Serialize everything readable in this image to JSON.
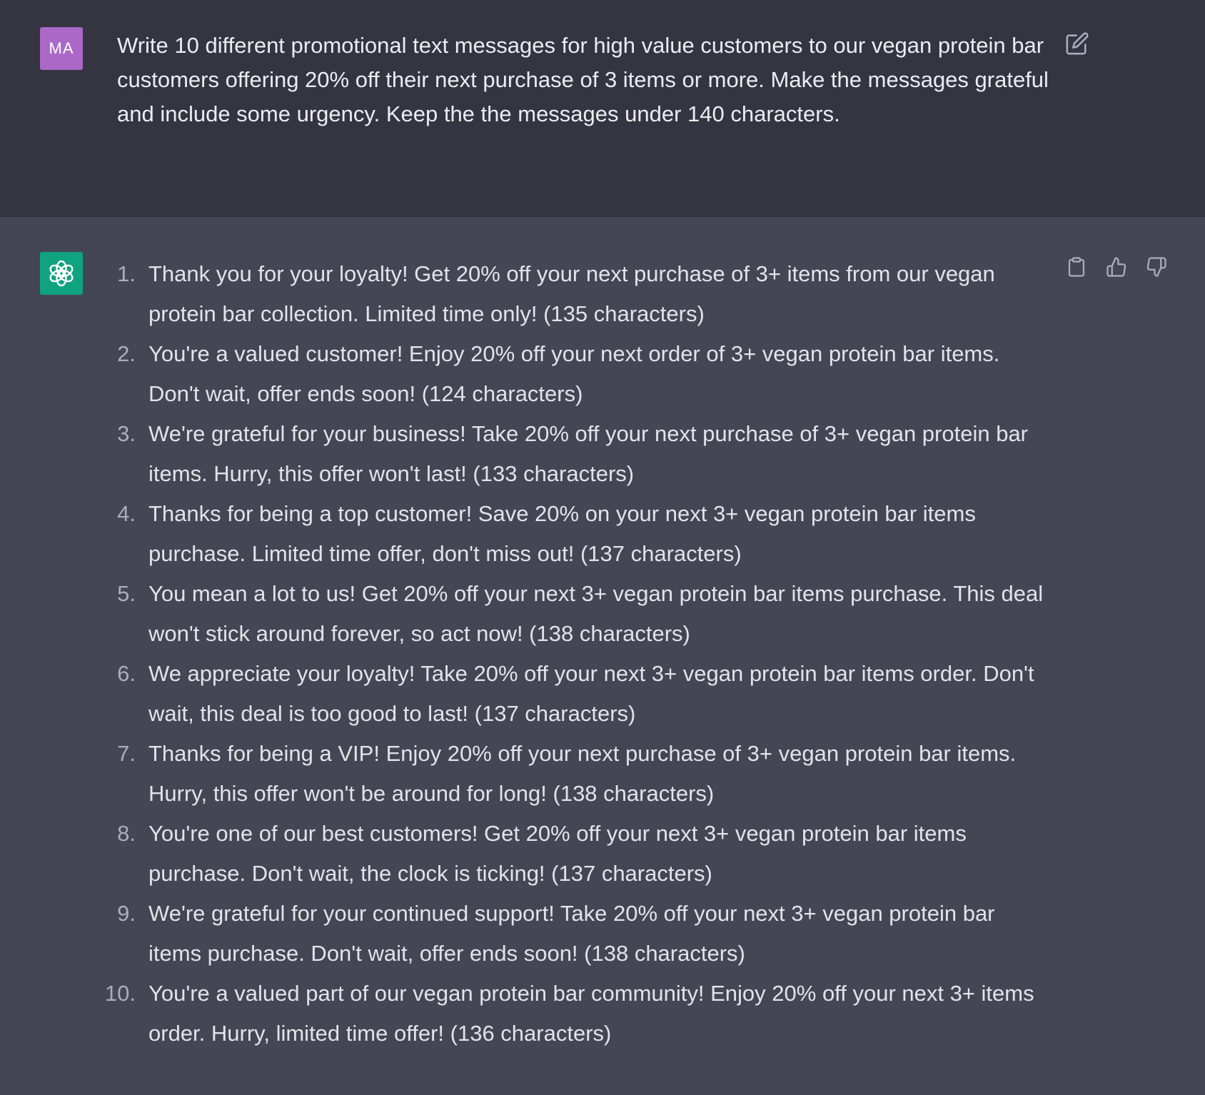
{
  "user_message": {
    "avatar_initials": "MA",
    "text": "Write 10 different promotional text messages for high value customers to our vegan protein bar customers offering 20% off their next purchase of 3 items or more. Make the messages grateful and include some urgency. Keep the the messages under 140 characters."
  },
  "assistant_message": {
    "items": [
      {
        "number": "1.",
        "text": "Thank you for your loyalty! Get 20% off your next purchase of 3+ items from our vegan protein bar collection. Limited time only! (135 characters)"
      },
      {
        "number": "2.",
        "text": "You're a valued customer! Enjoy 20% off your next order of 3+ vegan protein bar items. Don't wait, offer ends soon! (124 characters)"
      },
      {
        "number": "3.",
        "text": "We're grateful for your business! Take 20% off your next purchase of 3+ vegan protein bar items. Hurry, this offer won't last! (133 characters)"
      },
      {
        "number": "4.",
        "text": "Thanks for being a top customer! Save 20% on your next 3+ vegan protein bar items purchase. Limited time offer, don't miss out! (137 characters)"
      },
      {
        "number": "5.",
        "text": "You mean a lot to us! Get 20% off your next 3+ vegan protein bar items purchase. This deal won't stick around forever, so act now! (138 characters)"
      },
      {
        "number": "6.",
        "text": "We appreciate your loyalty! Take 20% off your next 3+ vegan protein bar items order. Don't wait, this deal is too good to last! (137 characters)"
      },
      {
        "number": "7.",
        "text": "Thanks for being a VIP! Enjoy 20% off your next purchase of 3+ vegan protein bar items. Hurry, this offer won't be around for long! (138 characters)"
      },
      {
        "number": "8.",
        "text": "You're one of our best customers! Get 20% off your next 3+ vegan protein bar items purchase. Don't wait, the clock is ticking! (137 characters)"
      },
      {
        "number": "9.",
        "text": "We're grateful for your continued support! Take 20% off your next 3+ vegan protein bar items purchase. Don't wait, offer ends soon! (138 characters)"
      },
      {
        "number": "10.",
        "text": "You're a valued part of our vegan protein bar community! Enjoy 20% off your next 3+ items order. Hurry, limited time offer! (136 characters)"
      }
    ]
  },
  "icons": {
    "edit": "edit-icon",
    "copy": "clipboard-icon",
    "thumbs_up": "thumbs-up-icon",
    "thumbs_down": "thumbs-down-icon",
    "assistant_logo": "openai-logo-icon"
  },
  "colors": {
    "user_bg": "#343541",
    "assistant_bg": "#444654",
    "user_avatar": "#ab68c6",
    "assistant_avatar": "#10a37f",
    "text": "#ececf1",
    "icon": "#acacbe"
  }
}
